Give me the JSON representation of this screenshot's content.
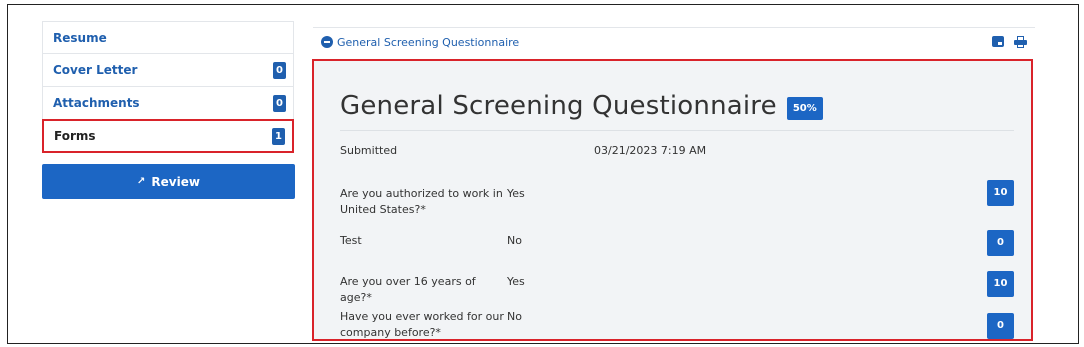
{
  "sidebar": {
    "items": [
      {
        "label": "Resume",
        "count": ""
      },
      {
        "label": "Cover Letter",
        "count": "0"
      },
      {
        "label": "Attachments",
        "count": "0"
      },
      {
        "label": "Forms",
        "count": "1"
      }
    ],
    "review_label": "Review"
  },
  "panel": {
    "header_title": "General Screening Questionnaire"
  },
  "form": {
    "title": "General Screening Questionnaire",
    "percent": "50%",
    "submitted_label": "Submitted",
    "submitted_value": "03/21/2023 7:19 AM",
    "questions": [
      {
        "q": "Are you authorized to work in United States?*",
        "a": "Yes",
        "score": "10"
      },
      {
        "q": "Test",
        "a": "No",
        "score": "0"
      },
      {
        "q": "Are you over 16 years of age?*",
        "a": "Yes",
        "score": "10"
      },
      {
        "q": "Have you ever worked for our company before?*",
        "a": "No",
        "score": "0"
      }
    ]
  },
  "colors": {
    "accent": "#1c66c4",
    "link": "#1f5fae",
    "highlight": "#d9232a",
    "panel_bg": "#f2f4f6"
  }
}
